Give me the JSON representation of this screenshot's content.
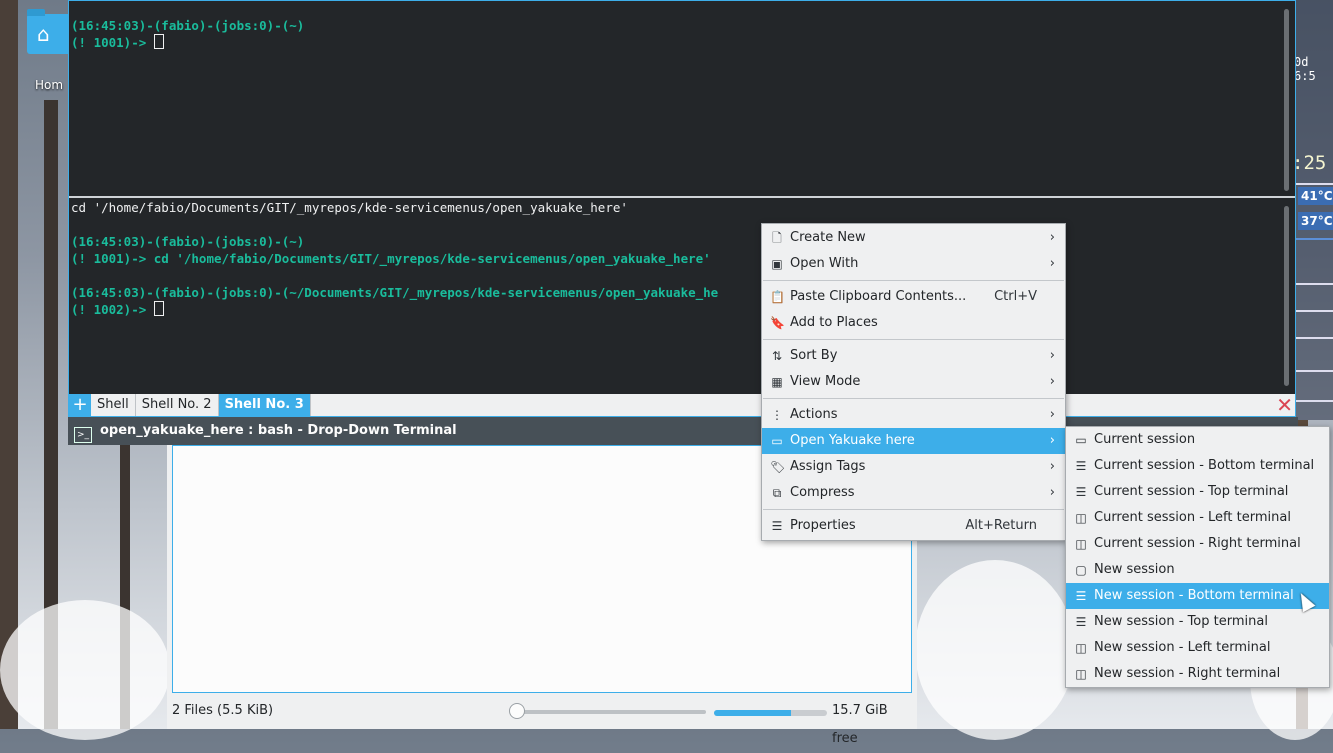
{
  "desktop": {
    "home_label": "Hom"
  },
  "widgets": {
    "uptime": "0d 6:5",
    "clock": ":25",
    "temp1": "41°C",
    "temp2": "37°C"
  },
  "terminal": {
    "top_pane": [
      {
        "prompt": "(16:45:03)-(fabio)-(jobs:0)-(~)"
      },
      {
        "prompt2": "(! 1001)-> "
      }
    ],
    "bottom_pane": {
      "line1": "cd '/home/fabio/Documents/GIT/_myrepos/kde-servicemenus/open_yakuake_here'",
      "line3": "(16:45:03)-(fabio)-(jobs:0)-(~)",
      "line4": "(! 1001)-> cd '/home/fabio/Documents/GIT/_myrepos/kde-servicemenus/open_yakuake_here'",
      "line6": "(16:45:03)-(fabio)-(jobs:0)-(~/Documents/GIT/_myrepos/kde-servicemenus/open_yakuake_he",
      "line7": "(! 1002)-> "
    },
    "tabs": [
      "Shell",
      "Shell No. 2",
      "Shell No. 3"
    ],
    "active_tab": "Shell No. 3"
  },
  "dolphin": {
    "title": "open_yakuake_here : bash - Drop-Down Terminal",
    "status_files": "2 Files (5.5 KiB)",
    "free_space": "15.7 GiB free",
    "free_fraction": 0.68
  },
  "context_menu": {
    "create_new": "Create New",
    "open_with": "Open With",
    "paste": "Paste Clipboard Contents...",
    "paste_shortcut": "Ctrl+V",
    "add_places": "Add to Places",
    "sort_by": "Sort By",
    "view_mode": "View Mode",
    "actions": "Actions",
    "open_yakuake": "Open Yakuake here",
    "assign_tags": "Assign Tags",
    "compress": "Compress",
    "properties": "Properties",
    "properties_shortcut": "Alt+Return"
  },
  "submenu": {
    "items": [
      "Current session",
      "Current session - Bottom terminal",
      "Current session - Top terminal",
      "Current session - Left terminal",
      "Current session - Right terminal",
      "New session",
      "New session - Bottom terminal",
      "New session - Top terminal",
      "New session - Left terminal",
      "New session - Right terminal"
    ],
    "highlighted": "New session - Bottom terminal"
  },
  "colors": {
    "accent": "#3daee9",
    "terminal_bg": "#232629",
    "prompt_green": "#1abc9c"
  }
}
